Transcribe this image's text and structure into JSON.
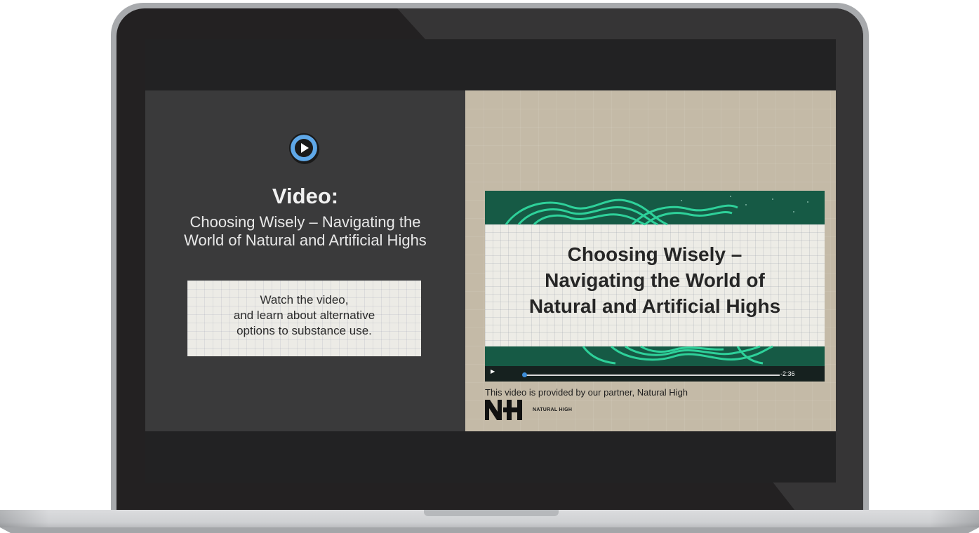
{
  "left_panel": {
    "heading": "Video:",
    "subtitle_lines": [
      "Choosing Wisely – Navigating the",
      "World of Natural and Artificial Highs"
    ],
    "instructions": [
      "Watch the video,",
      "and learn about alternative",
      "options to substance use."
    ]
  },
  "video_player": {
    "title_lines": [
      "Choosing Wisely  –",
      "Navigating the World of",
      "Natural and Artificial Highs"
    ],
    "time_remaining": "-2:36",
    "play_icon": "play-triangle"
  },
  "partner": {
    "credit": "This video is provided by our partner, Natural High",
    "logo_wordmark": "NATURAL HIGH",
    "logo_letters": "NH"
  },
  "colors": {
    "accent_blue": "#5fa8e8",
    "forest_green": "#165a45",
    "wave_green": "#2ed19a",
    "panel_dark": "#3a3a3b",
    "panel_tan": "#c4baa7"
  }
}
